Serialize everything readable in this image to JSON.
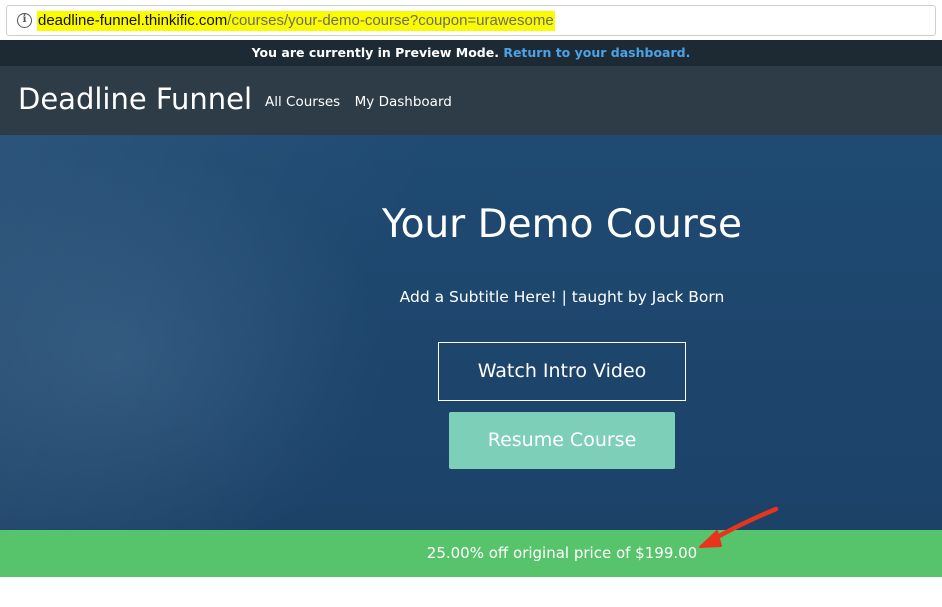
{
  "browser": {
    "url_host": "deadline-funnel.thinkific.com",
    "url_path": "/courses/your-demo-course?coupon=urawesome",
    "info_icon": "info-icon",
    "highlight_color": "#fbfb00"
  },
  "preview_banner": {
    "text": "You are currently in Preview Mode.",
    "link": "Return to your dashboard."
  },
  "nav": {
    "brand": "Deadline Funnel",
    "links": [
      "All Courses",
      "My Dashboard"
    ]
  },
  "hero": {
    "title": "Your Demo Course",
    "subtitle": "Add a Subtitle Here! | taught by Jack Born",
    "intro_button": "Watch Intro Video",
    "resume_button": "Resume Course"
  },
  "discount": {
    "text": "25.00% off original price of $199.00"
  },
  "annotation": {
    "icon": "red-arrow-icon",
    "color": "#e8341c"
  },
  "colors": {
    "preview_bg": "#1d2a33",
    "nav_bg": "#2e3c47",
    "hero_bg": "#1f4a72",
    "resume_button": "#7ecfb7",
    "discount_bar": "#57c46c",
    "link": "#4aa3e8"
  }
}
